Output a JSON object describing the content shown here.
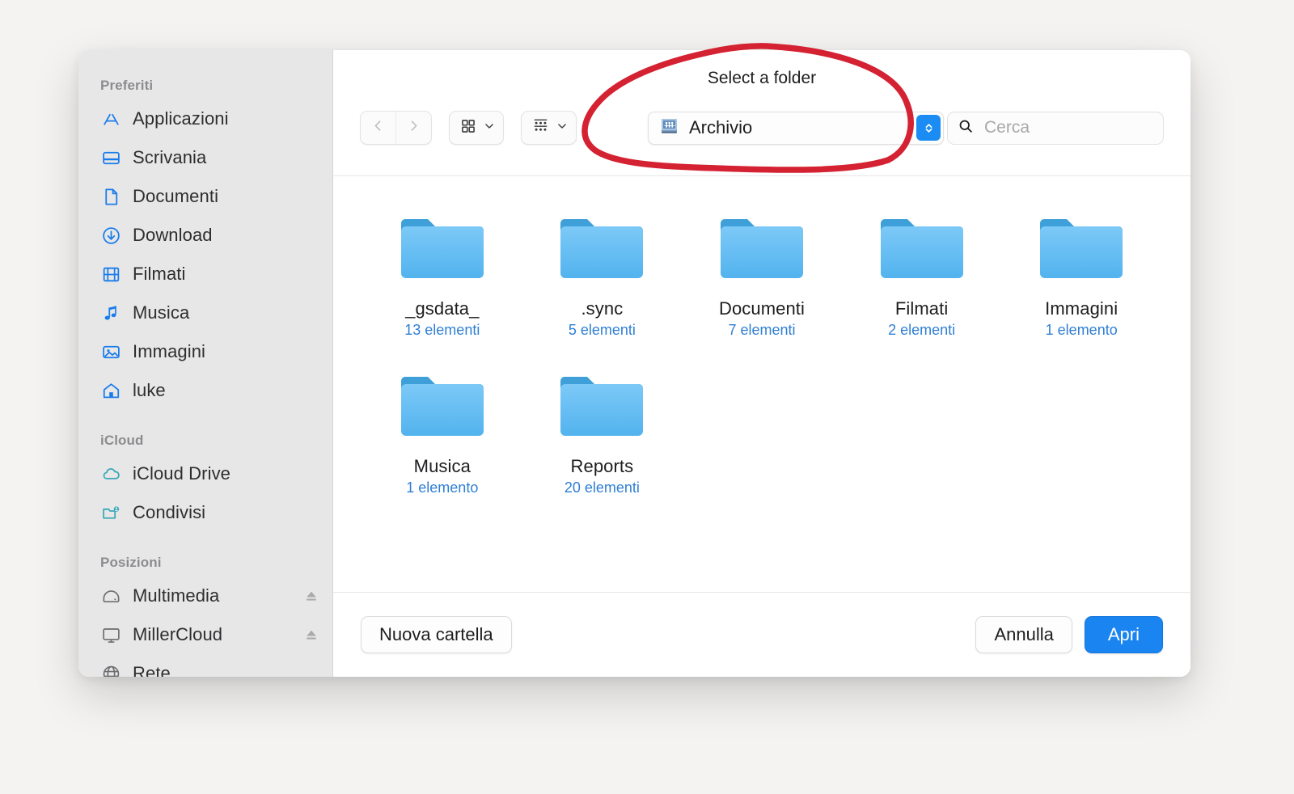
{
  "window": {
    "prompt": "Select a folder"
  },
  "sidebar": {
    "groups": [
      {
        "title": "Preferiti",
        "items": [
          {
            "label": "Applicazioni",
            "icon": "appstore-icon"
          },
          {
            "label": "Scrivania",
            "icon": "desktop-icon"
          },
          {
            "label": "Documenti",
            "icon": "document-icon"
          },
          {
            "label": "Download",
            "icon": "download-icon"
          },
          {
            "label": "Filmati",
            "icon": "film-icon"
          },
          {
            "label": "Musica",
            "icon": "music-note-icon"
          },
          {
            "label": "Immagini",
            "icon": "photo-icon"
          },
          {
            "label": "luke",
            "icon": "home-icon"
          }
        ]
      },
      {
        "title": "iCloud",
        "items": [
          {
            "label": "iCloud Drive",
            "icon": "cloud-icon"
          },
          {
            "label": "Condivisi",
            "icon": "shared-folder-icon"
          }
        ]
      },
      {
        "title": "Posizioni",
        "items": [
          {
            "label": "Multimedia",
            "icon": "disk-icon",
            "eject": true
          },
          {
            "label": "MillerCloud",
            "icon": "display-icon",
            "eject": true
          },
          {
            "label": "Rete",
            "icon": "globe-icon",
            "eject": false
          }
        ]
      }
    ]
  },
  "toolbar": {
    "back_icon": "chevron-left-icon",
    "forward_icon": "chevron-right-icon",
    "view_mode_icon": "grid-view-icon",
    "arrange_icon": "group-view-icon",
    "folder_select": {
      "label": "Archivio",
      "icon": "shared-network-folder-icon"
    },
    "search": {
      "placeholder": "Cerca",
      "value": "",
      "icon": "search-icon"
    }
  },
  "files": [
    {
      "name": "_gsdata_",
      "count": "13 elementi"
    },
    {
      "name": ".sync",
      "count": "5 elementi"
    },
    {
      "name": "Documenti",
      "count": "7 elementi"
    },
    {
      "name": "Filmati",
      "count": "2 elementi"
    },
    {
      "name": "Immagini",
      "count": "1 elemento"
    },
    {
      "name": "Musica",
      "count": "1 elemento"
    },
    {
      "name": "Reports",
      "count": "20 elementi"
    }
  ],
  "footer": {
    "new_folder": "Nuova cartella",
    "cancel": "Annulla",
    "open": "Apri"
  },
  "colors": {
    "accent_blue": "#1a84f0",
    "sidebar_icon_blue": "#1a7ceb",
    "icloud_teal": "#3aa8b8",
    "count_blue": "#2f7fd4",
    "annotation_red": "#d42232",
    "folder_blue": "#61bdf5",
    "sidebar_bg": "#e7e7e7"
  }
}
